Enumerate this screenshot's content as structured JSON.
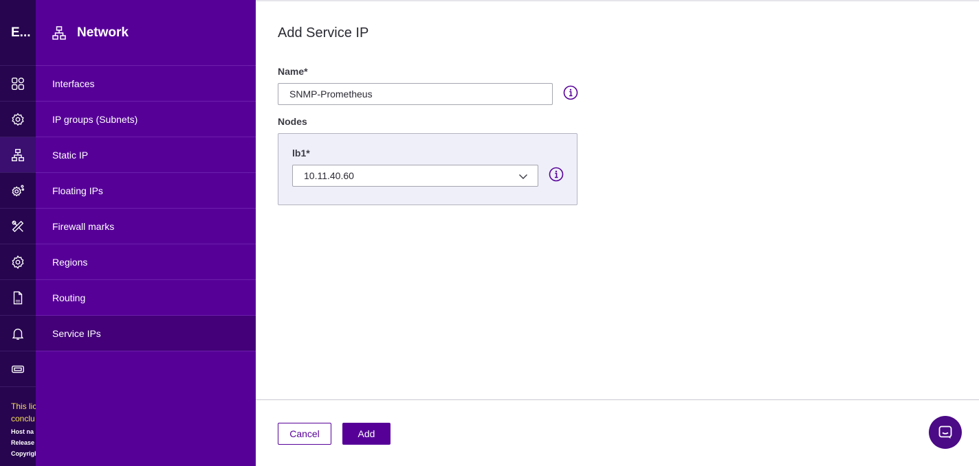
{
  "rail": {
    "brand": "E...",
    "icons": [
      "grid-icon",
      "settings-cluster-icon",
      "network-icon",
      "gear-nodes-icon",
      "tools-icon",
      "gear-icon",
      "log-file-icon",
      "bell-icon",
      "ticket-icon"
    ],
    "footer": {
      "warning_line1": "This lic",
      "warning_line2": "conclu",
      "info_line1": "Host na",
      "info_line2": "Release",
      "info_line3": "Copyrigh"
    }
  },
  "subnav": {
    "title": "Network",
    "items": [
      {
        "label": "Interfaces"
      },
      {
        "label": "IP groups (Subnets)"
      },
      {
        "label": "Static IP"
      },
      {
        "label": "Floating IPs"
      },
      {
        "label": "Firewall marks"
      },
      {
        "label": "Regions"
      },
      {
        "label": "Routing"
      },
      {
        "label": "Service IPs",
        "active": true
      }
    ]
  },
  "form": {
    "title": "Add Service IP",
    "name_label": "Name*",
    "name_value": "SNMP-Prometheus",
    "nodes_label": "Nodes",
    "node": {
      "label": "lb1*",
      "selected": "10.11.40.60"
    },
    "cancel_label": "Cancel",
    "add_label": "Add"
  },
  "colors": {
    "rail_bg": "#27054f",
    "subnav_bg": "#560098",
    "accent": "#560098",
    "warning_text": "#f5e05a"
  }
}
